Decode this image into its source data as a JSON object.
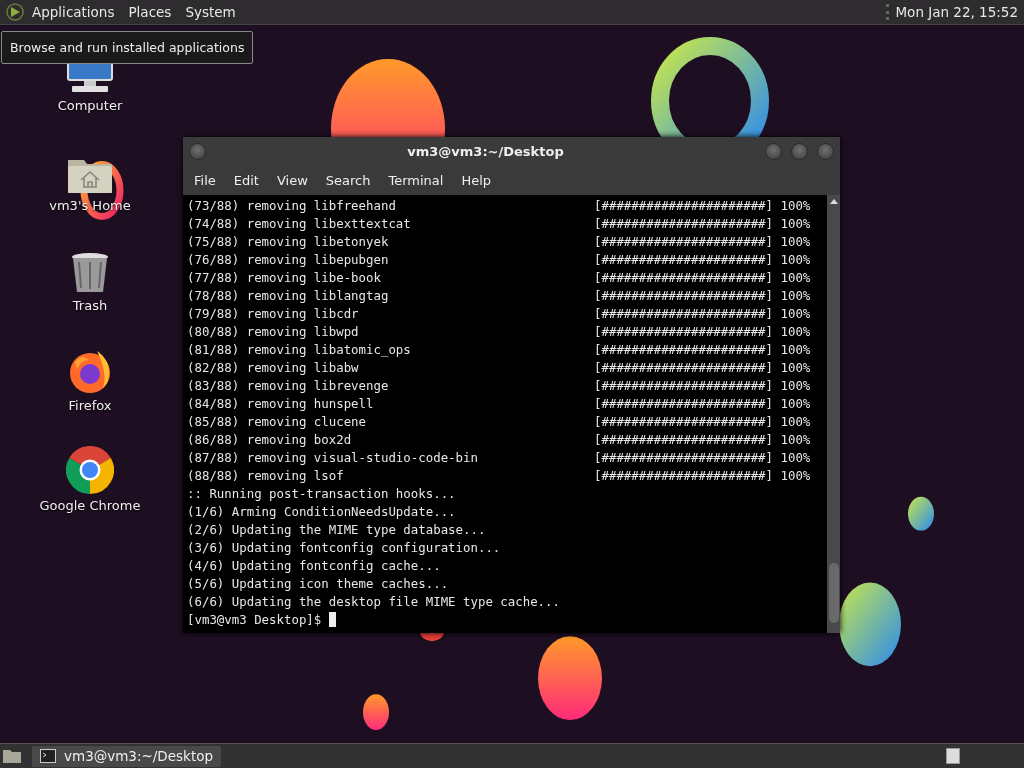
{
  "top_panel": {
    "menus": [
      "Applications",
      "Places",
      "System"
    ],
    "clock": "Mon Jan 22, 15:52"
  },
  "tooltip": "Browse and run installed applications",
  "desktop_icons": [
    {
      "kind": "computer",
      "label": "Computer"
    },
    {
      "kind": "home",
      "label": "vm3's Home"
    },
    {
      "kind": "trash",
      "label": "Trash"
    },
    {
      "kind": "firefox",
      "label": "Firefox"
    },
    {
      "kind": "chrome",
      "label": "Google Chrome"
    }
  ],
  "terminal": {
    "title": "vm3@vm3:~/Desktop",
    "menu": [
      "File",
      "Edit",
      "View",
      "Search",
      "Terminal",
      "Help"
    ],
    "lines": [
      {
        "kind": "progress",
        "text": "(73/88) removing libfreehand",
        "progress": "[######################] 100%"
      },
      {
        "kind": "progress",
        "text": "(74/88) removing libexttextcat",
        "progress": "[######################] 100%"
      },
      {
        "kind": "progress",
        "text": "(75/88) removing libetonyek",
        "progress": "[######################] 100%"
      },
      {
        "kind": "progress",
        "text": "(76/88) removing libepubgen",
        "progress": "[######################] 100%"
      },
      {
        "kind": "progress",
        "text": "(77/88) removing libe-book",
        "progress": "[######################] 100%"
      },
      {
        "kind": "progress",
        "text": "(78/88) removing liblangtag",
        "progress": "[######################] 100%"
      },
      {
        "kind": "progress",
        "text": "(79/88) removing libcdr",
        "progress": "[######################] 100%"
      },
      {
        "kind": "progress",
        "text": "(80/88) removing libwpd",
        "progress": "[######################] 100%"
      },
      {
        "kind": "progress",
        "text": "(81/88) removing libatomic_ops",
        "progress": "[######################] 100%"
      },
      {
        "kind": "progress",
        "text": "(82/88) removing libabw",
        "progress": "[######################] 100%"
      },
      {
        "kind": "progress",
        "text": "(83/88) removing librevenge",
        "progress": "[######################] 100%"
      },
      {
        "kind": "progress",
        "text": "(84/88) removing hunspell",
        "progress": "[######################] 100%"
      },
      {
        "kind": "progress",
        "text": "(85/88) removing clucene",
        "progress": "[######################] 100%"
      },
      {
        "kind": "progress",
        "text": "(86/88) removing box2d",
        "progress": "[######################] 100%"
      },
      {
        "kind": "progress",
        "text": "(87/88) removing visual-studio-code-bin",
        "progress": "[######################] 100%"
      },
      {
        "kind": "progress",
        "text": "(88/88) removing lsof",
        "progress": "[######################] 100%"
      },
      {
        "kind": "plain",
        "text": ":: Running post-transaction hooks..."
      },
      {
        "kind": "plain",
        "text": "(1/6) Arming ConditionNeedsUpdate..."
      },
      {
        "kind": "plain",
        "text": "(2/6) Updating the MIME type database..."
      },
      {
        "kind": "plain",
        "text": "(3/6) Updating fontconfig configuration..."
      },
      {
        "kind": "plain",
        "text": "(4/6) Updating fontconfig cache..."
      },
      {
        "kind": "plain",
        "text": "(5/6) Updating icon theme caches..."
      },
      {
        "kind": "plain",
        "text": "(6/6) Updating the desktop file MIME type cache..."
      }
    ],
    "prompt": "[vm3@vm3 Desktop]$"
  },
  "taskbar": {
    "tasks": [
      {
        "label": "vm3@vm3:~/Desktop",
        "selected": false
      }
    ]
  }
}
